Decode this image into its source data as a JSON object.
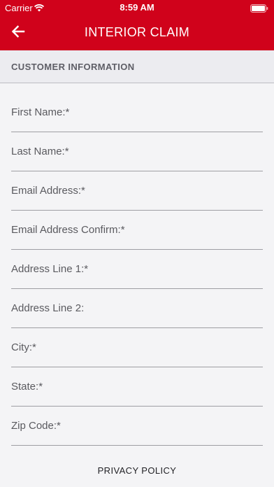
{
  "status_bar": {
    "carrier": "Carrier",
    "time": "8:59 AM",
    "wifi_icon": "wifi-icon",
    "battery_icon": "battery-icon"
  },
  "header": {
    "title": "INTERIOR CLAIM",
    "back_icon": "arrow-left-icon",
    "background_color": "#d0021b"
  },
  "section": {
    "title": "CUSTOMER INFORMATION"
  },
  "form": {
    "fields": [
      {
        "label": "First Name:*"
      },
      {
        "label": "Last Name:*"
      },
      {
        "label": "Email Address:*"
      },
      {
        "label": "Email Address Confirm:*"
      },
      {
        "label": "Address Line 1:*"
      },
      {
        "label": "Address Line 2:"
      },
      {
        "label": "City:*"
      },
      {
        "label": "State:*"
      },
      {
        "label": "Zip Code:*"
      }
    ]
  },
  "footer": {
    "privacy_label": "PRIVACY POLICY"
  }
}
